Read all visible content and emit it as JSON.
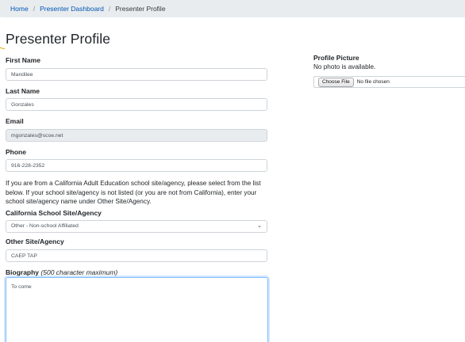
{
  "breadcrumb": {
    "items": [
      {
        "label": "Home"
      },
      {
        "label": "Presenter Dashboard"
      },
      {
        "label": "Presenter Profile"
      }
    ],
    "separator": "/"
  },
  "page": {
    "title": "Presenter Profile"
  },
  "form": {
    "first_name": {
      "label": "First Name",
      "value": "Mandilee"
    },
    "last_name": {
      "label": "Last Name",
      "value": "Gonzales"
    },
    "email": {
      "label": "Email",
      "value": "mgonzales@scoe.net"
    },
    "phone": {
      "label": "Phone",
      "value": "916-228-2352"
    },
    "help_text": "If you are from a California Adult Education school site/agency, please select from the list below. If your school site/agency is not listed (or you are not from California), enter your school site/agency name under Other Site/Agency.",
    "school_site": {
      "label": "California School Site/Agency",
      "selected": "Other - Non-school Affiliated"
    },
    "other_site": {
      "label": "Other Site/Agency",
      "value": "CAEP TAP"
    },
    "biography": {
      "label": "Biography",
      "hint": "(500 character maximum)",
      "value": "To come"
    }
  },
  "profile_picture": {
    "label": "Profile Picture",
    "status": "No photo is available.",
    "choose_button": "Choose File",
    "file_status": "No file chosen"
  },
  "colors": {
    "link": "#0056b3",
    "focus_border": "#80bdff",
    "readonly_bg": "#e9ecef"
  }
}
